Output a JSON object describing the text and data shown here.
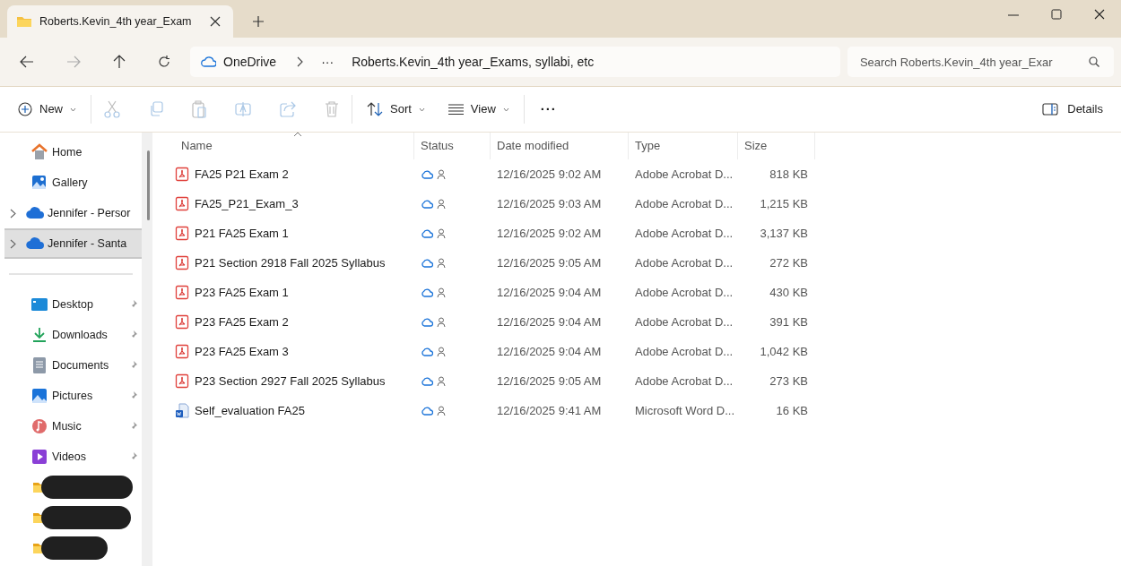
{
  "tab": {
    "title": "Roberts.Kevin_4th year_Exam"
  },
  "address": {
    "root": "OneDrive",
    "overflow": "···",
    "path": "Roberts.Kevin_4th year_Exams, syllabi, etc"
  },
  "search": {
    "placeholder": "Search Roberts.Kevin_4th year_Exar"
  },
  "toolbar": {
    "new": "New",
    "sort": "Sort",
    "view": "View",
    "more": "···",
    "details": "Details"
  },
  "sidebar": {
    "items": [
      {
        "kind": "nav",
        "label": "Home",
        "selected": false
      },
      {
        "kind": "nav",
        "label": "Gallery",
        "selected": false
      },
      {
        "kind": "cloud",
        "label": "Jennifer - Persor",
        "selected": false
      },
      {
        "kind": "cloud",
        "label": "Jennifer - Santa",
        "selected": true
      },
      {
        "kind": "divider"
      },
      {
        "kind": "pinned",
        "label": "Desktop",
        "selected": false
      },
      {
        "kind": "pinned",
        "label": "Downloads",
        "selected": false
      },
      {
        "kind": "pinned",
        "label": "Documents",
        "selected": false
      },
      {
        "kind": "pinned",
        "label": "Pictures",
        "selected": false
      },
      {
        "kind": "pinned",
        "label": "Music",
        "selected": false
      },
      {
        "kind": "pinned",
        "label": "Videos",
        "selected": false
      },
      {
        "kind": "redacted"
      },
      {
        "kind": "redacted"
      },
      {
        "kind": "redacted"
      }
    ]
  },
  "table": {
    "columns": [
      {
        "label": "Name",
        "sorted": true
      },
      {
        "label": "Status",
        "sorted": false
      },
      {
        "label": "Date modified",
        "sorted": false
      },
      {
        "label": "Type",
        "sorted": false
      },
      {
        "label": "Size",
        "sorted": false
      }
    ],
    "rows": [
      {
        "kind": "pdf",
        "name": "FA25 P21 Exam 2",
        "date": "12/16/2025 9:02 AM",
        "type": "Adobe Acrobat D...",
        "size": "818 KB",
        "selected": false
      },
      {
        "kind": "pdf",
        "name": "FA25_P21_Exam_3",
        "date": "12/16/2025 9:03 AM",
        "type": "Adobe Acrobat D...",
        "size": "1,215 KB",
        "selected": false
      },
      {
        "kind": "pdf",
        "name": "P21 FA25 Exam 1",
        "date": "12/16/2025 9:02 AM",
        "type": "Adobe Acrobat D...",
        "size": "3,137 KB",
        "selected": false
      },
      {
        "kind": "pdf",
        "name": "P21 Section 2918 Fall 2025 Syllabus",
        "date": "12/16/2025 9:05 AM",
        "type": "Adobe Acrobat D...",
        "size": "272 KB",
        "selected": false
      },
      {
        "kind": "pdf",
        "name": "P23 FA25 Exam 1",
        "date": "12/16/2025 9:04 AM",
        "type": "Adobe Acrobat D...",
        "size": "430 KB",
        "selected": false
      },
      {
        "kind": "pdf",
        "name": "P23 FA25 Exam 2",
        "date": "12/16/2025 9:04 AM",
        "type": "Adobe Acrobat D...",
        "size": "391 KB",
        "selected": false
      },
      {
        "kind": "pdf",
        "name": "P23 FA25 Exam 3",
        "date": "12/16/2025 9:04 AM",
        "type": "Adobe Acrobat D...",
        "size": "1,042 KB",
        "selected": false
      },
      {
        "kind": "pdf",
        "name": "P23 Section 2927 Fall 2025 Syllabus",
        "date": "12/16/2025 9:05 AM",
        "type": "Adobe Acrobat D...",
        "size": "273 KB",
        "selected": false
      },
      {
        "kind": "word",
        "name": "Self_evaluation FA25",
        "date": "12/16/2025 9:41 AM",
        "type": "Microsoft Word D...",
        "size": "16 KB",
        "selected": false
      }
    ]
  }
}
